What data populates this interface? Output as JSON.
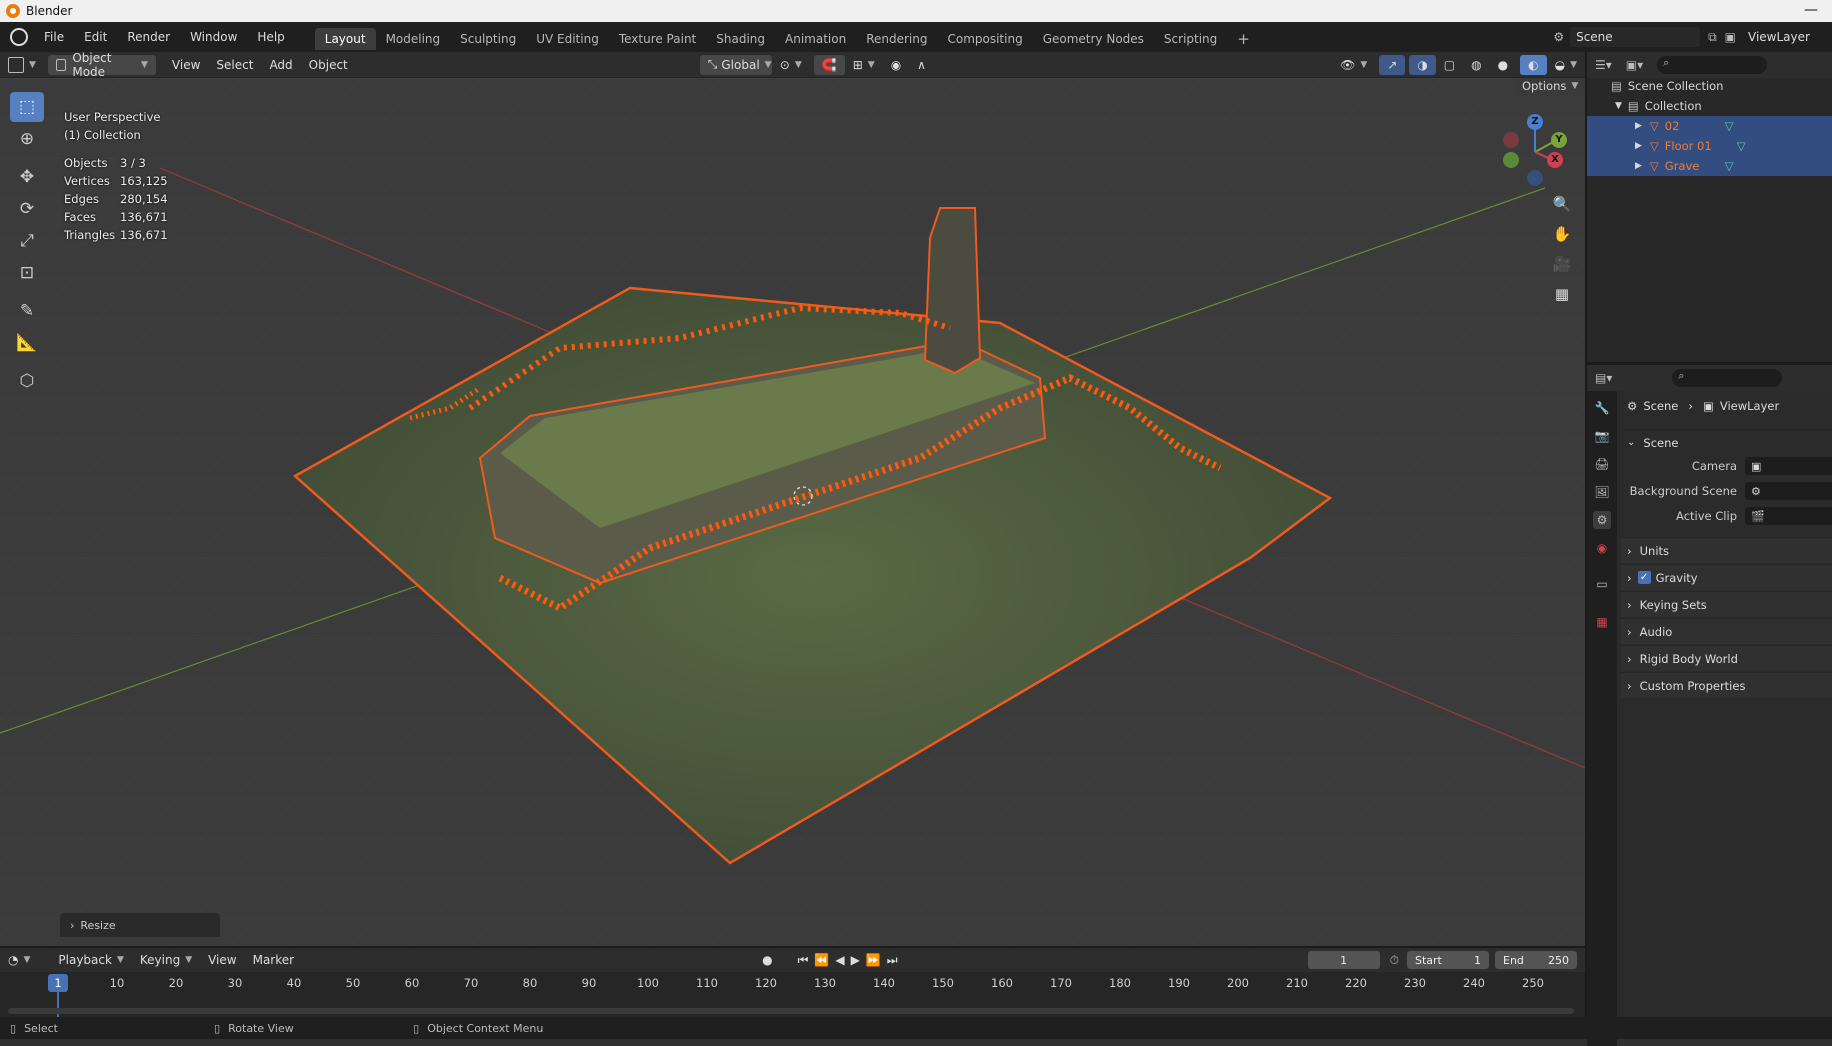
{
  "app": {
    "title": "Blender"
  },
  "menu": {
    "items": [
      "File",
      "Edit",
      "Render",
      "Window",
      "Help"
    ]
  },
  "workspaces": {
    "tabs": [
      "Layout",
      "Modeling",
      "Sculpting",
      "UV Editing",
      "Texture Paint",
      "Shading",
      "Animation",
      "Rendering",
      "Compositing",
      "Geometry Nodes",
      "Scripting"
    ],
    "active": "Layout",
    "add": "+"
  },
  "scene_selector": {
    "value": "Scene"
  },
  "viewlayer_selector": {
    "value": "ViewLayer"
  },
  "viewport_header": {
    "mode": "Object Mode",
    "menus": [
      "View",
      "Select",
      "Add",
      "Object"
    ],
    "orientation": "Global",
    "options": "Options"
  },
  "overlay_info": {
    "perspective": "User Perspective",
    "collection": "(1) Collection",
    "stats": [
      {
        "label": "Objects",
        "value": "3 / 3"
      },
      {
        "label": "Vertices",
        "value": "163,125"
      },
      {
        "label": "Edges",
        "value": "280,154"
      },
      {
        "label": "Faces",
        "value": "136,671"
      },
      {
        "label": "Triangles",
        "value": "136,671"
      }
    ]
  },
  "gizmo": {
    "x": "X",
    "y": "Y",
    "z": "Z"
  },
  "last_operator": {
    "label": "Resize"
  },
  "outliner": {
    "scene_collection": "Scene Collection",
    "collection": "Collection",
    "objects": [
      "02",
      "Floor 01",
      "Grave"
    ]
  },
  "properties": {
    "breadcrumb": [
      "Scene",
      "ViewLayer"
    ],
    "panel_title": "Scene",
    "fields": [
      {
        "label": "Camera"
      },
      {
        "label": "Background Scene"
      },
      {
        "label": "Active Clip"
      }
    ],
    "subpanels": [
      "Units",
      "Gravity",
      "Keying Sets",
      "Audio",
      "Rigid Body World",
      "Custom Properties"
    ],
    "gravity_checked": true
  },
  "timeline": {
    "menus": [
      "Playback",
      "Keying",
      "View",
      "Marker"
    ],
    "current_frame": "1",
    "start_label": "Start",
    "start_value": "1",
    "end_label": "End",
    "end_value": "250",
    "ticks": [
      "10",
      "20",
      "30",
      "40",
      "50",
      "60",
      "70",
      "80",
      "90",
      "100",
      "110",
      "120",
      "130",
      "140",
      "150",
      "160",
      "170",
      "180",
      "190",
      "200",
      "210",
      "220",
      "230",
      "240",
      "250"
    ],
    "playhead": "1"
  },
  "statusbar": {
    "items": [
      "Select",
      "Rotate View",
      "Object Context Menu"
    ]
  },
  "colors": {
    "accent": "#5680c2",
    "selection": "#f05a1e",
    "outliner_selected": "#334d80",
    "object_name": "#f07c30"
  }
}
